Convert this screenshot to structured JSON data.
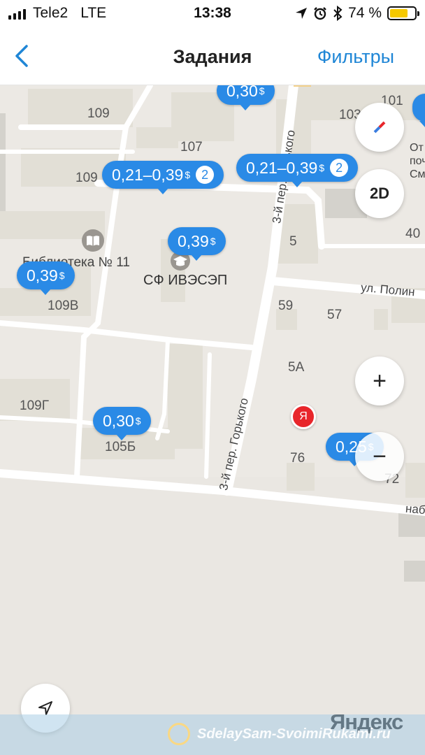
{
  "status_bar": {
    "carrier": "Tele2",
    "network": "LTE",
    "time": "13:38",
    "battery_percent": "74 %",
    "battery_level": 0.74,
    "icons": [
      "signal-icon",
      "location-arrow-icon",
      "alarm-icon",
      "bluetooth-icon",
      "battery-icon"
    ]
  },
  "nav": {
    "back_icon": "chevron-left-icon",
    "title": "Задания",
    "filters_label": "Фильтры"
  },
  "map": {
    "labels": {
      "l109": "109",
      "l107": "107",
      "l103": "103",
      "l101": "101",
      "l109b": "109",
      "l5": "5",
      "l40": "40",
      "library": "Библиотека № 11",
      "institute": "СФ ИВЭСЭП",
      "l109v": "109В",
      "l59": "59",
      "l57": "57",
      "l5a": "5А",
      "l109g": "109Г",
      "l105b": "105Б",
      "l76": "76",
      "l72": "72",
      "post": "Отделение почтовой связи Смоленск",
      "post_short_1": "От",
      "post_short_2": "почто",
      "post_short_3": "Смоле",
      "street_gorkogo_top": "3-й пер. Горького",
      "street_gorkogo_bottom": "3-й пер. Горького",
      "street_polina": "ул. Полин",
      "street_nab": "наб"
    },
    "pins": {
      "p1": {
        "price": "0,30",
        "currency": "$"
      },
      "p2": {
        "price": "0,21–0,39",
        "currency": "$",
        "count": "2"
      },
      "p3": {
        "price": "0,21–0,39",
        "currency": "$",
        "count": "2"
      },
      "p4": {
        "price": "0,39",
        "currency": "$"
      },
      "p5": {
        "price": "0,39",
        "currency": "$"
      },
      "p6": {
        "price": "0,30",
        "currency": "$"
      },
      "p7": {
        "price": "0,25",
        "currency": "$"
      }
    },
    "controls": {
      "compass_icon": "compass-icon",
      "mode_label": "2D",
      "zoom_in_label": "+",
      "zoom_out_label": "−",
      "locate_icon": "navigation-arrow-icon"
    },
    "user_marker_label": "Я",
    "brand": "Яндекс"
  },
  "watermark": "SdelaySam-SvoimiRukami.ru"
}
